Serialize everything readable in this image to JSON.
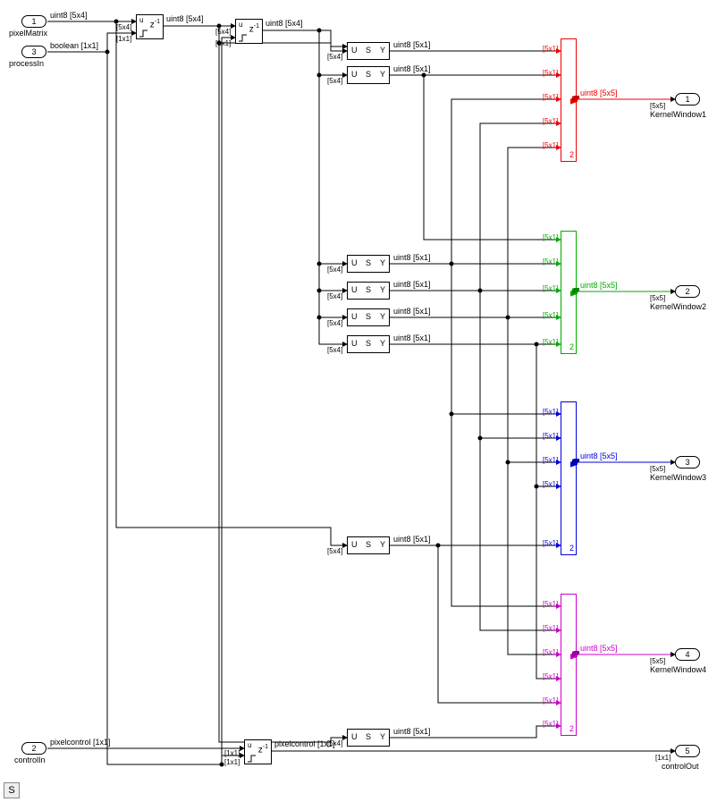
{
  "inports": {
    "pixelMatrix": {
      "num": "1",
      "name": "pixelMatrix",
      "type": "uint8 [5x4]"
    },
    "controlIn": {
      "num": "2",
      "name": "controlIn",
      "type": "pixelcontrol [1x1]"
    },
    "processIn": {
      "num": "3",
      "name": "processIn",
      "type": "boolean [1x1]"
    }
  },
  "outports": {
    "kw1": {
      "num": "1",
      "name": "KernelWindow1",
      "dim": "[5x5]"
    },
    "kw2": {
      "num": "2",
      "name": "KernelWindow2",
      "dim": "[5x5]"
    },
    "kw3": {
      "num": "3",
      "name": "KernelWindow3",
      "dim": "[5x5]"
    },
    "kw4": {
      "num": "4",
      "name": "KernelWindow4",
      "dim": "[5x5]"
    },
    "co": {
      "num": "5",
      "name": "controlOut",
      "dim": "[1x1]"
    }
  },
  "delay": {
    "d1_out": "uint8 [5x4]",
    "d2_out": "uint8 [5x4]",
    "d3_out": "pixelcontrol [1x1]"
  },
  "selectors": {
    "s1": {
      "out": "uint8 [5x1]"
    },
    "s2": {
      "out": "uint8 [5x1]"
    },
    "s3": {
      "out": "uint8 [5x1]"
    },
    "s4": {
      "out": "uint8 [5x1]"
    },
    "s5": {
      "out": "uint8 [5x1]"
    },
    "s6": {
      "out": "uint8 [5x1]"
    },
    "s7": {
      "out": "uint8 [5x1]"
    },
    "s8": {
      "out": "uint8 [5x1]"
    }
  },
  "concat": {
    "out_type": "uint8 [5x5]",
    "in_dim": "[5x1]",
    "param": "2"
  },
  "dims": {
    "d5x4": "[5x4]",
    "d1x1": "[1x1]"
  },
  "glyph": {
    "u": "u",
    "z": "z",
    "neg1": "-1",
    "U": "U",
    "S": "S",
    "Y": "Y"
  },
  "status": "S"
}
